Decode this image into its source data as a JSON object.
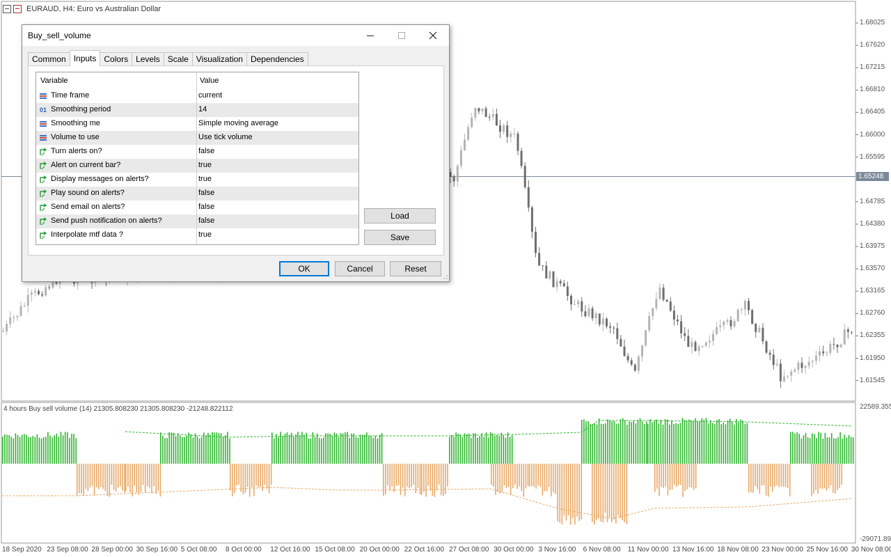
{
  "chart": {
    "title": "EURAUD, H4:  Euro vs Australian Dollar",
    "current_price": "1.65248",
    "price_ticks": [
      "1.68025",
      "1.67620",
      "1.67215",
      "1.66810",
      "1.66405",
      "1.66000",
      "1.65595",
      "1.64785",
      "1.64380",
      "1.63975",
      "1.63570",
      "1.63165",
      "1.62760",
      "1.62355",
      "1.61950",
      "1.61545"
    ],
    "date_ticks": [
      "18 Sep 2020",
      "23 Sep 08:00",
      "28 Sep 00:00",
      "30 Sep 16:00",
      "5 Oct 08:00",
      "8 Oct 00:00",
      "12 Oct 16:00",
      "15 Oct 08:00",
      "20 Oct 00:00",
      "22 Oct 16:00",
      "27 Oct 08:00",
      "30 Oct 00:00",
      "3 Nov 16:00",
      "6 Nov 08:00",
      "11 Nov 00:00",
      "13 Nov 16:00",
      "18 Nov 08:00",
      "23 Nov 00:00",
      "25 Nov 16:00",
      "30 Nov 08:00"
    ],
    "bull_color": "#b4b4b4",
    "bear_color": "#6e6e6e"
  },
  "indicator": {
    "title": "4 hours Buy sell volume (14) 21305.808230 21305.808230 -21248.822112",
    "scale_top": "22589.3552",
    "scale_bottom": "-29071.891",
    "buy_color": "#2db52d",
    "sell_color": "#e8a866"
  },
  "dialog": {
    "title": "Buy_sell_volume",
    "tabs": [
      "Common",
      "Inputs",
      "Colors",
      "Levels",
      "Scale",
      "Visualization",
      "Dependencies"
    ],
    "active_tab": "Inputs",
    "columns": {
      "variable": "Variable",
      "value": "Value"
    },
    "rows": [
      {
        "icon": "enum-icon",
        "name": "Time frame",
        "value": "current"
      },
      {
        "icon": "int-icon",
        "name": "Smoothing period",
        "value": "14"
      },
      {
        "icon": "enum-icon",
        "name": "Smoothing me",
        "value": "Simple moving average"
      },
      {
        "icon": "enum-icon",
        "name": "Volume to use",
        "value": "Use tick volume"
      },
      {
        "icon": "bool-icon",
        "name": "Turn alerts on?",
        "value": "false"
      },
      {
        "icon": "bool-icon",
        "name": "Alert on current bar?",
        "value": "true"
      },
      {
        "icon": "bool-icon",
        "name": "Display messages on alerts?",
        "value": "true"
      },
      {
        "icon": "bool-icon",
        "name": "Play sound on alerts?",
        "value": "false"
      },
      {
        "icon": "bool-icon",
        "name": "Send email on alerts?",
        "value": "false"
      },
      {
        "icon": "bool-icon",
        "name": "Send push notification on alerts?",
        "value": "false"
      },
      {
        "icon": "bool-icon",
        "name": "Interpolate mtf data ?",
        "value": "true"
      }
    ],
    "load_label": "Load",
    "save_label": "Save",
    "ok_label": "OK",
    "cancel_label": "Cancel",
    "reset_label": "Reset"
  }
}
